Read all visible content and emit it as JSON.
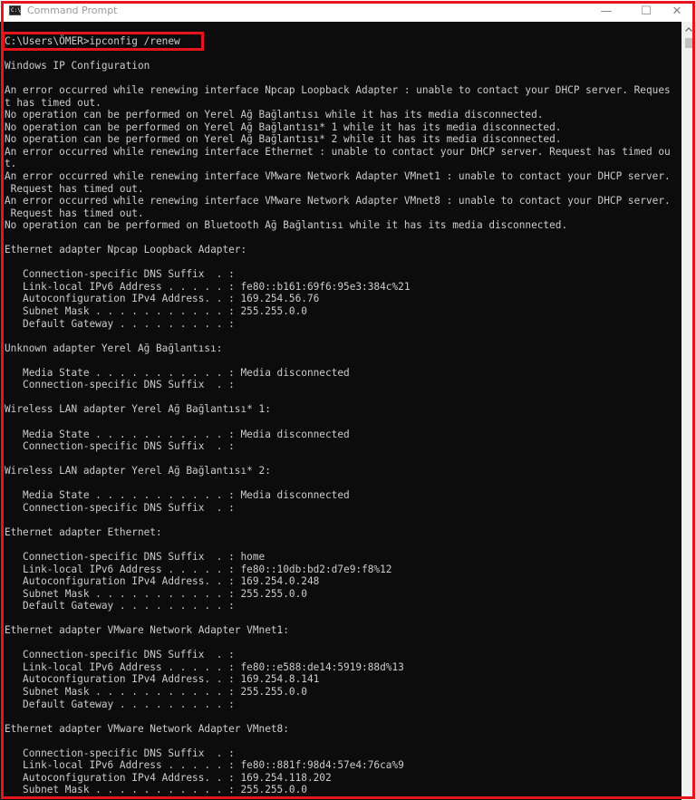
{
  "window": {
    "title": "Command Prompt",
    "icon_label": "C:\\",
    "minimize_glyph": "—",
    "maximize_glyph": "☐",
    "close_glyph": "✕"
  },
  "colors": {
    "console_background": "#0c0c0c",
    "console_text": "#cccccc",
    "highlight": "#e8141c"
  },
  "console": {
    "lines": [
      "C:\\Users\\ÖMER>ipconfig /renew",
      "",
      "Windows IP Configuration",
      "",
      "An error occurred while renewing interface Npcap Loopback Adapter : unable to contact your DHCP server. Reques",
      "t has timed out.",
      "No operation can be performed on Yerel Ağ Bağlantısı while it has its media disconnected.",
      "No operation can be performed on Yerel Ağ Bağlantısı* 1 while it has its media disconnected.",
      "No operation can be performed on Yerel Ağ Bağlantısı* 2 while it has its media disconnected.",
      "An error occurred while renewing interface Ethernet : unable to contact your DHCP server. Request has timed ou",
      "t.",
      "An error occurred while renewing interface VMware Network Adapter VMnet1 : unable to contact your DHCP server.",
      " Request has timed out.",
      "An error occurred while renewing interface VMware Network Adapter VMnet8 : unable to contact your DHCP server.",
      " Request has timed out.",
      "No operation can be performed on Bluetooth Ağ Bağlantısı while it has its media disconnected.",
      "",
      "Ethernet adapter Npcap Loopback Adapter:",
      "",
      "   Connection-specific DNS Suffix  . :",
      "   Link-local IPv6 Address . . . . . : fe80::b161:69f6:95e3:384c%21",
      "   Autoconfiguration IPv4 Address. . : 169.254.56.76",
      "   Subnet Mask . . . . . . . . . . . : 255.255.0.0",
      "   Default Gateway . . . . . . . . . :",
      "",
      "Unknown adapter Yerel Ağ Bağlantısı:",
      "",
      "   Media State . . . . . . . . . . . : Media disconnected",
      "   Connection-specific DNS Suffix  . :",
      "",
      "Wireless LAN adapter Yerel Ağ Bağlantısı* 1:",
      "",
      "   Media State . . . . . . . . . . . : Media disconnected",
      "   Connection-specific DNS Suffix  . :",
      "",
      "Wireless LAN adapter Yerel Ağ Bağlantısı* 2:",
      "",
      "   Media State . . . . . . . . . . . : Media disconnected",
      "   Connection-specific DNS Suffix  . :",
      "",
      "Ethernet adapter Ethernet:",
      "",
      "   Connection-specific DNS Suffix  . : home",
      "   Link-local IPv6 Address . . . . . : fe80::10db:bd2:d7e9:f8%12",
      "   Autoconfiguration IPv4 Address. . : 169.254.0.248",
      "   Subnet Mask . . . . . . . . . . . : 255.255.0.0",
      "   Default Gateway . . . . . . . . . :",
      "",
      "Ethernet adapter VMware Network Adapter VMnet1:",
      "",
      "   Connection-specific DNS Suffix  . :",
      "   Link-local IPv6 Address . . . . . : fe80::e588:de14:5919:88d%13",
      "   Autoconfiguration IPv4 Address. . : 169.254.8.141",
      "   Subnet Mask . . . . . . . . . . . : 255.255.0.0",
      "   Default Gateway . . . . . . . . . :",
      "",
      "Ethernet adapter VMware Network Adapter VMnet8:",
      "",
      "   Connection-specific DNS Suffix  . :",
      "   Link-local IPv6 Address . . . . . : fe80::881f:98d4:57e4:76ca%9",
      "   Autoconfiguration IPv4 Address. . : 169.254.118.202",
      "   Subnet Mask . . . . . . . . . . . : 255.255.0.0"
    ]
  }
}
